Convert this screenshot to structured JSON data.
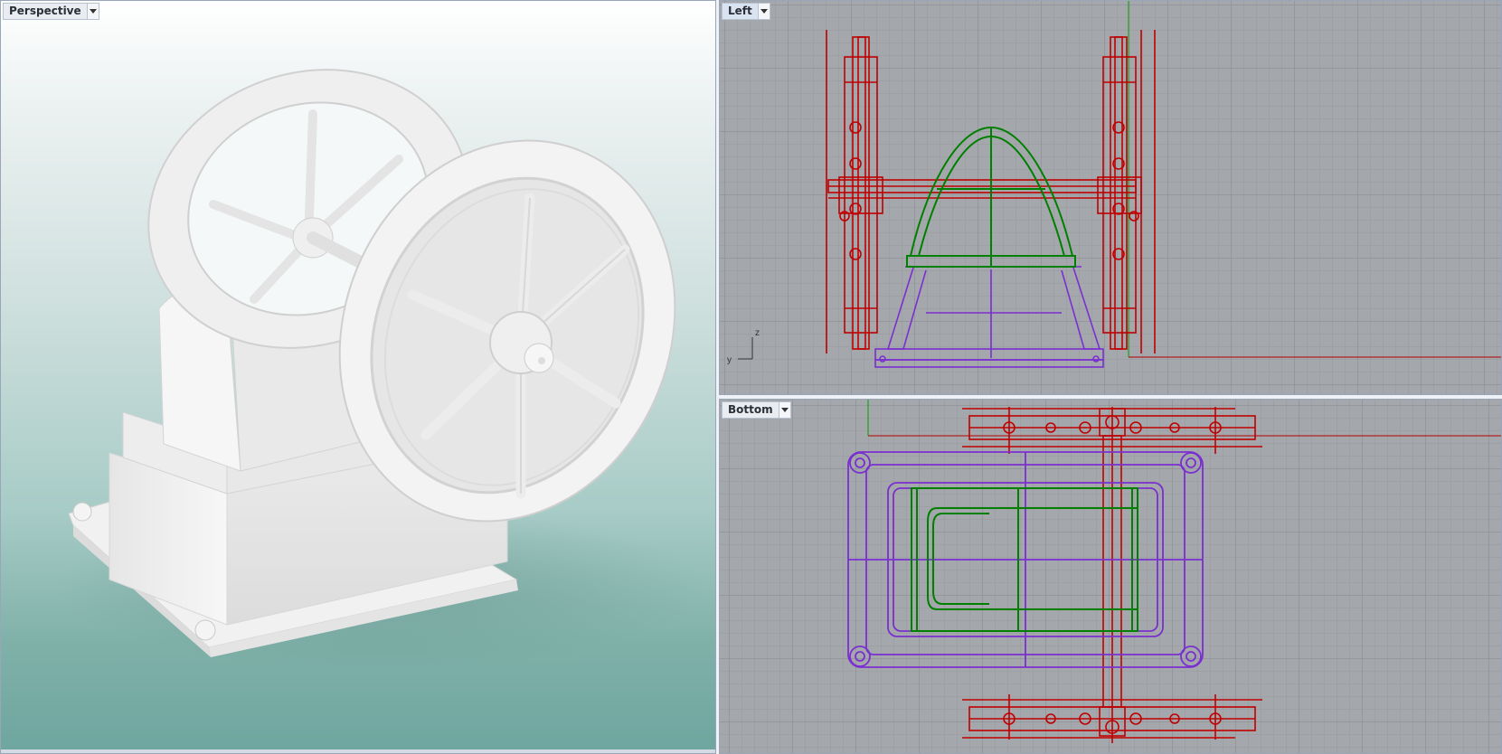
{
  "viewports": {
    "perspective": {
      "label": "Perspective",
      "menu_icon": "dropdown-arrow-icon"
    },
    "left": {
      "label": "Left",
      "menu_icon": "dropdown-arrow-icon",
      "axis_z": "z",
      "axis_y": "y"
    },
    "bottom": {
      "label": "Bottom",
      "menu_icon": "dropdown-arrow-icon"
    }
  },
  "colors": {
    "grid_bg": "#a4a7ab",
    "grid_minor": "#9b9ea2",
    "grid_major": "#8e9195",
    "axis_red": "#b40000",
    "axis_green": "#00a000",
    "wire_red": "#c00000",
    "wire_green": "#008000",
    "wire_purple": "#7b2fd0",
    "model_white": "#f4f4f4"
  }
}
